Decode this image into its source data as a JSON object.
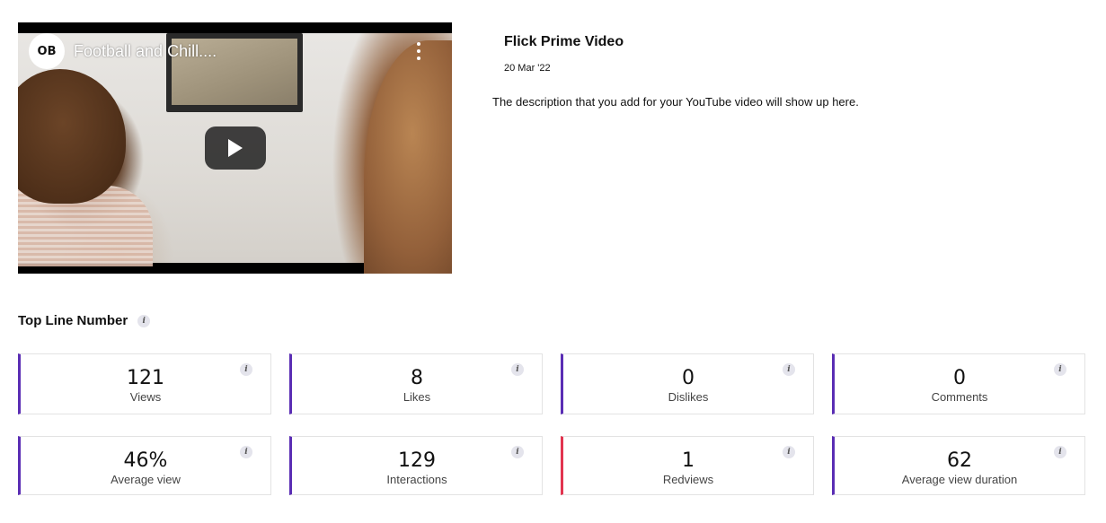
{
  "video": {
    "title": "Football and Chill....",
    "logo_text": "OB",
    "icons": {
      "kebab": "more-vertical-icon",
      "play": "play-icon",
      "info": "info-icon"
    }
  },
  "meta": {
    "channel": "Flick Prime Video",
    "date": "20 Mar '22",
    "description": "The description that you add for your YouTube video will show up here."
  },
  "section": {
    "title": "Top Line Number"
  },
  "colors": {
    "accent_purple": "#5a2db4",
    "accent_red": "#e2344f"
  },
  "metrics": [
    {
      "value": "121",
      "label": "Views"
    },
    {
      "value": "8",
      "label": "Likes"
    },
    {
      "value": "0",
      "label": "Dislikes"
    },
    {
      "value": "0",
      "label": "Comments"
    },
    {
      "value": "46%",
      "label": "Average view"
    },
    {
      "value": "129",
      "label": "Interactions"
    },
    {
      "value": "1",
      "label": "Redviews"
    },
    {
      "value": "62",
      "label": "Average view duration"
    }
  ],
  "info_glyph": "i"
}
